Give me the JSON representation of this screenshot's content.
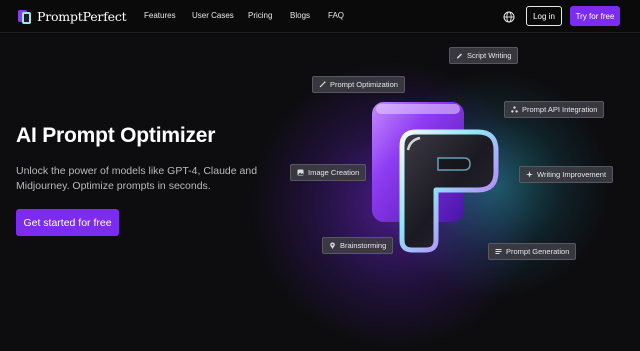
{
  "brand": {
    "name": "PromptPerfect"
  },
  "nav": {
    "links": [
      "Features",
      "User Cases",
      "Pricing",
      "Blogs",
      "FAQ"
    ],
    "login_label": "Log in",
    "try_label": "Try for free"
  },
  "hero": {
    "title": "AI Prompt Optimizer",
    "subtitle": "Unlock the power of models like GPT-4, Claude and Midjourney. Optimize prompts in seconds.",
    "cta_label": "Get started for free"
  },
  "chips": [
    {
      "label": "Script Writing",
      "icon": "script-icon"
    },
    {
      "label": "Prompt Optimization",
      "icon": "magic-wand-icon"
    },
    {
      "label": "Prompt API Integration",
      "icon": "api-icon"
    },
    {
      "label": "Image Creation",
      "icon": "image-icon"
    },
    {
      "label": "Writing Improvement",
      "icon": "sparkle-icon"
    },
    {
      "label": "Brainstorming",
      "icon": "pin-icon"
    },
    {
      "label": "Prompt Generation",
      "icon": "list-icon"
    }
  ],
  "colors": {
    "accent": "#7c2cf0",
    "background": "#0d0d0f",
    "cyan_glow": "#9be6f5"
  }
}
